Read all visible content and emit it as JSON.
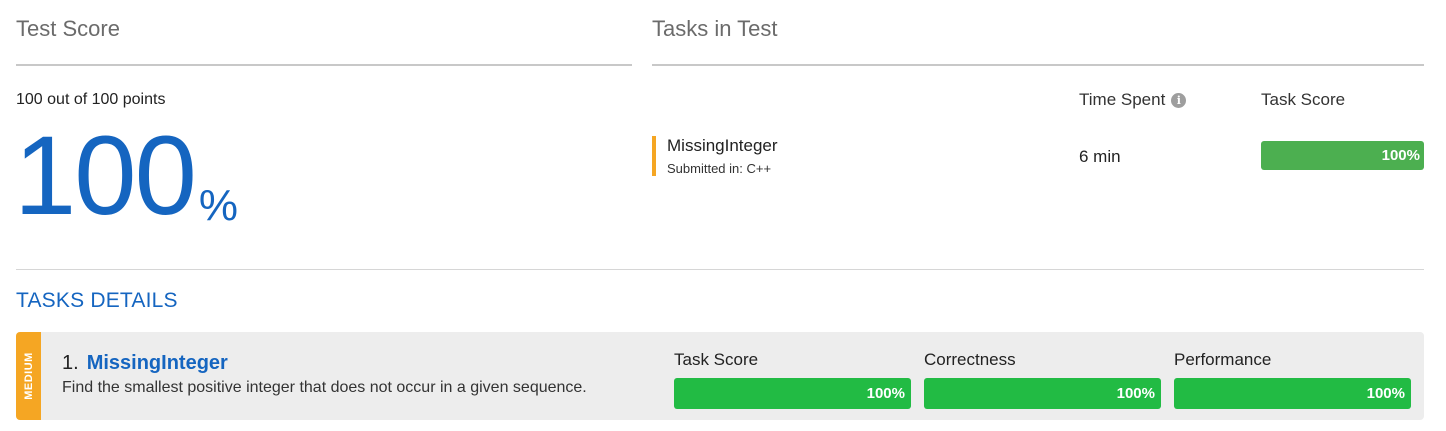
{
  "test_score": {
    "title": "Test Score",
    "points_text": "100 out of 100 points",
    "score_number": "100",
    "score_symbol": "%"
  },
  "tasks_in_test": {
    "title": "Tasks in Test",
    "columns": {
      "time_spent": "Time Spent",
      "task_score": "Task Score"
    },
    "info_icon": "info-icon",
    "tasks": [
      {
        "name": "MissingInteger",
        "submitted_in": "Submitted in: C++",
        "time": "6 min",
        "score_label": "100%",
        "score_fraction": 1.0,
        "accent_color": "#f5a623",
        "bar_color": "#4caf50"
      }
    ]
  },
  "tasks_details": {
    "title": "TASKS DETAILS",
    "items": [
      {
        "difficulty": "MEDIUM",
        "number": "1.",
        "name": "MissingInteger",
        "description": "Find the smallest positive integer that does not occur in a given sequence.",
        "metrics": [
          {
            "label": "Task Score",
            "value": "100%",
            "fraction": 1.0
          },
          {
            "label": "Correctness",
            "value": "100%",
            "fraction": 1.0
          },
          {
            "label": "Performance",
            "value": "100%",
            "fraction": 1.0
          }
        ]
      }
    ]
  },
  "colors": {
    "accent_blue": "#1565c0",
    "difficulty_medium": "#f5a623",
    "success_green": "#22bb44",
    "score_green": "#4caf50"
  }
}
